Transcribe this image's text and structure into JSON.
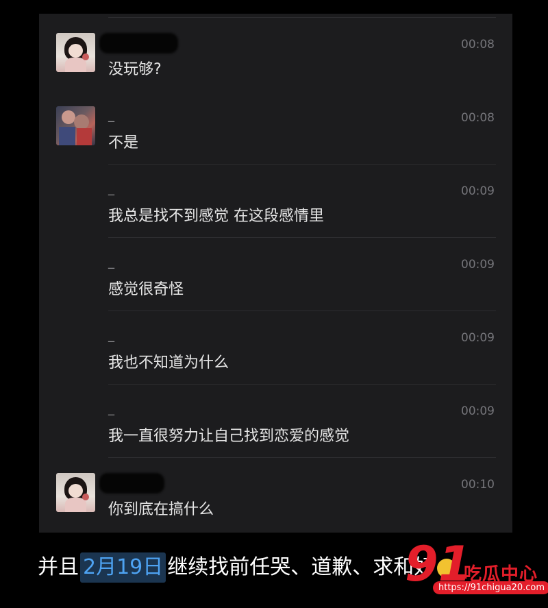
{
  "messages": [
    {
      "name": "",
      "time": "00:08",
      "text": "没玩够?",
      "avatar": "girl-avatar"
    },
    {
      "name": "_",
      "time": "00:08",
      "text": "不是",
      "avatar": "photo-avatar"
    },
    {
      "name": "_",
      "time": "00:09",
      "text": "我总是找不到感觉 在这段感情里",
      "avatar": ""
    },
    {
      "name": "_",
      "time": "00:09",
      "text": "感觉很奇怪",
      "avatar": ""
    },
    {
      "name": "_",
      "time": "00:09",
      "text": "我也不知道为什么",
      "avatar": ""
    },
    {
      "name": "_",
      "time": "00:09",
      "text": "我一直很努力让自己找到恋爱的感觉",
      "avatar": ""
    },
    {
      "name": "",
      "time": "00:10",
      "text": "你到底在搞什么",
      "avatar": "girl-avatar"
    }
  ],
  "caption": {
    "before": "并且",
    "highlight": "2月19日",
    "after": "继续找前任哭、道歉、求和好"
  },
  "watermark": {
    "number": "91",
    "brand": "吃瓜中心",
    "url": "https://91chigua20.com"
  }
}
